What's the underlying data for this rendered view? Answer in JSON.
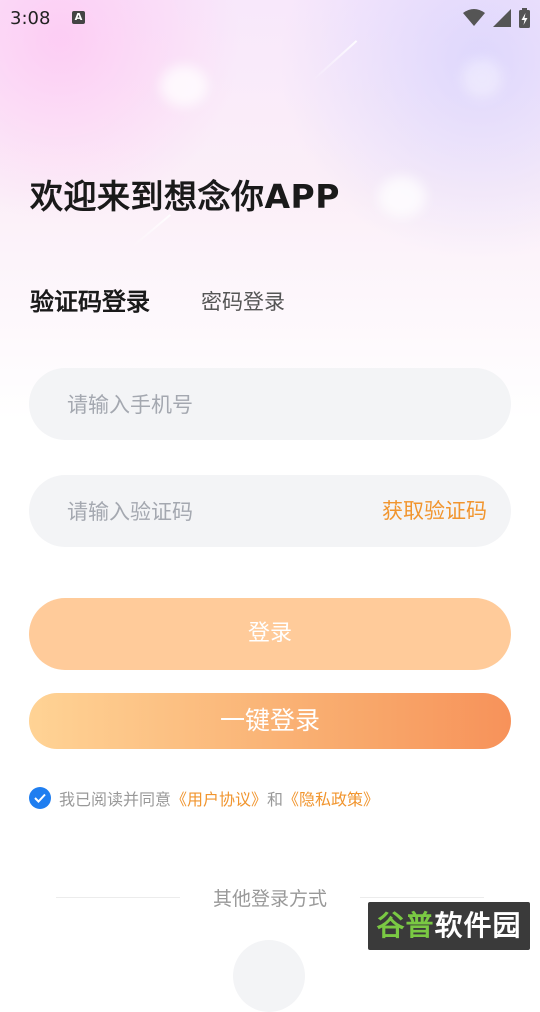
{
  "status_bar": {
    "time": "3:08",
    "a_badge": "A"
  },
  "welcome_title": "欢迎来到想念你APP",
  "tabs": {
    "active": "验证码登录",
    "inactive": "密码登录"
  },
  "phone_input": {
    "placeholder": "请输入手机号",
    "value": ""
  },
  "code_input": {
    "placeholder": "请输入验证码",
    "value": "",
    "get_code_label": "获取验证码"
  },
  "login_button": {
    "label": "登录"
  },
  "one_key_button": {
    "label": "一键登录"
  },
  "agreement": {
    "prefix": "我已阅读并同意",
    "user_agreement": "《用户协议》",
    "connector": "和",
    "privacy_policy": "《隐私政策》",
    "checked": true
  },
  "other_login": {
    "label": "其他登录方式"
  },
  "watermark": {
    "part1": "谷普",
    "part2": "软件园"
  },
  "colors": {
    "accent_orange": "#f1952e",
    "check_blue": "#1f7ef0",
    "login_button": "#ffcb9a"
  }
}
